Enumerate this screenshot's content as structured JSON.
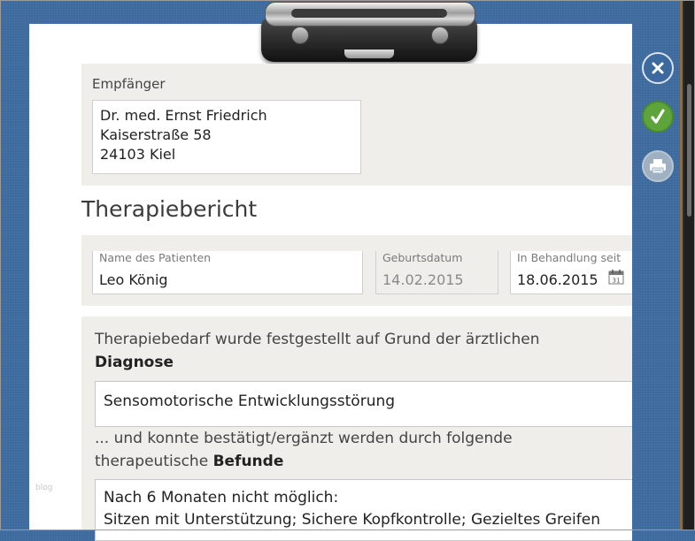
{
  "recipient": {
    "label": "Empfänger",
    "lines": [
      "Dr. med. Ernst Friedrich",
      "Kaiserstraße 58",
      "24103 Kiel"
    ]
  },
  "report": {
    "title": "Therapiebericht"
  },
  "patient": {
    "name_label": "Name des Patienten",
    "name_value": "Leo König",
    "birthdate_label": "Geburtsdatum",
    "birthdate_value": "14.02.2015",
    "treatment_label": "In Behandlung seit",
    "treatment_value": "18.06.2015",
    "calendar_day": "31"
  },
  "diagnosis": {
    "intro_text": "Therapiebedarf wurde festgestellt auf Grund der ärztlichen",
    "intro_bold": "Diagnose",
    "diagnosis_value": "Sensomotorische Entwicklungsstörung",
    "findings_text_1": "... und konnte bestätigt/ergänzt werden durch folgende",
    "findings_text_2": "therapeutische",
    "findings_bold": "Befunde",
    "findings_line_1": "Nach 6 Monaten nicht möglich:",
    "findings_line_2": "Sitzen mit Unterstützung; Sichere Kopfkontrolle; Gezieltes Greifen"
  },
  "watermark": "blog",
  "actions": {
    "close_icon": "close-icon",
    "confirm_icon": "checkmark-icon",
    "print_icon": "printer-icon"
  },
  "colors": {
    "background": "#3d6a9e",
    "confirm": "#5da43a",
    "section": "#f0eeeb"
  }
}
